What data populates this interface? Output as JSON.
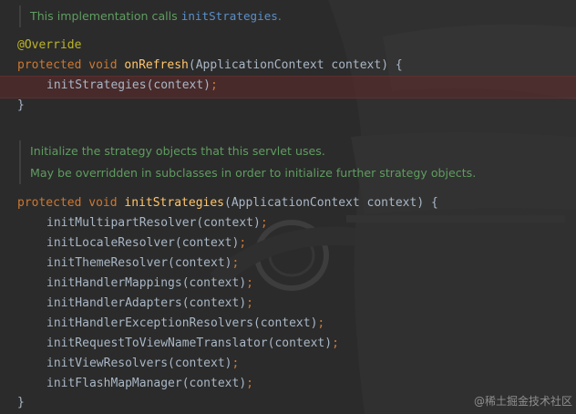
{
  "doc1": {
    "prefix": "This implementation calls ",
    "link": "initStrategies",
    "suffix": "."
  },
  "doc2": {
    "line1": "Initialize the strategy objects that this servlet uses.",
    "line2": "May be overridden in subclasses in order to initialize further strategy objects."
  },
  "code": {
    "annotation": "@Override",
    "kw_protected": "protected",
    "kw_void": "void",
    "onRefresh_name": "onRefresh",
    "onRefresh_params": "(ApplicationContext context) {",
    "onRefresh_body_call": "initStrategies(context)",
    "semicolon": ";",
    "close_brace": "}",
    "initStrategies_name": "initStrategies",
    "initStrategies_params": "(ApplicationContext context) {",
    "calls": [
      "initMultipartResolver(context)",
      "initLocaleResolver(context)",
      "initThemeResolver(context)",
      "initHandlerMappings(context)",
      "initHandlerAdapters(context)",
      "initHandlerExceptionResolvers(context)",
      "initRequestToViewNameTranslator(context)",
      "initViewResolvers(context)",
      "initFlashMapManager(context)"
    ]
  },
  "watermark": "@稀土掘金技术社区",
  "colors": {
    "background": "#2b2b2b",
    "keyword": "#cc7832",
    "method": "#ffc66d",
    "annotation": "#bbb529",
    "plain": "#a9b7c6",
    "doc_comment": "#5f9d60",
    "doc_link": "#5a8fc9",
    "breakpoint_line": "#602a2a"
  }
}
